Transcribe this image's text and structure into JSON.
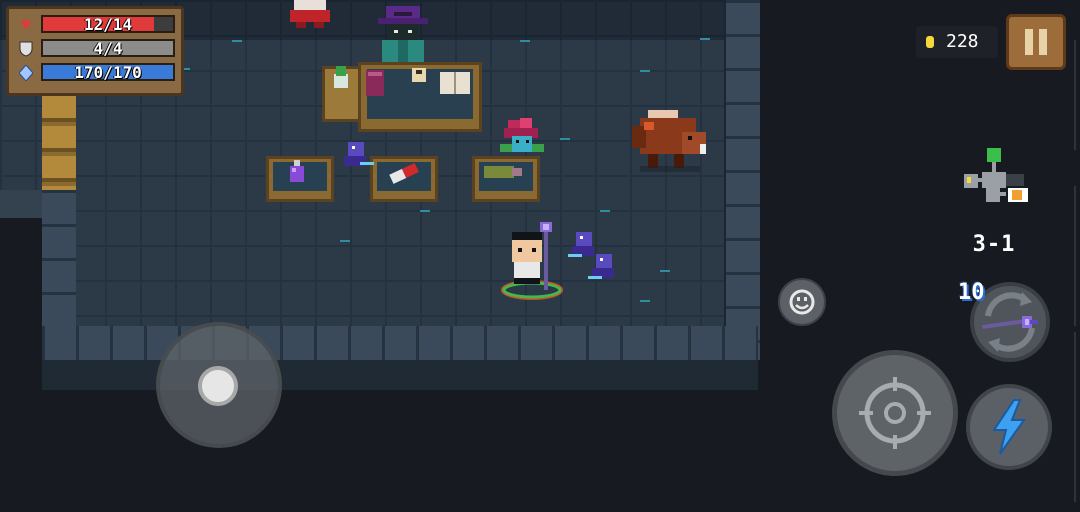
{
  "stats": {
    "hp": {
      "label": "12/14",
      "current": 12,
      "max": 14,
      "color": "#e03a3a"
    },
    "armor": {
      "label": "4/4",
      "current": 4,
      "max": 4,
      "color": "#8c8c8c"
    },
    "energy": {
      "label": "170/170",
      "current": 170,
      "max": 170,
      "color": "#3a7ad8"
    }
  },
  "coins": {
    "amount": "228"
  },
  "level": {
    "name": "3-1"
  },
  "weapon": {
    "energy_cost": "10"
  },
  "icons": {
    "heart": "heart-icon",
    "shield": "shield-icon",
    "energy": "diamond-icon",
    "coin": "coin-icon",
    "pause": "pause-icon",
    "emote": "smiley-icon",
    "attack": "crosshair-icon",
    "skill": "lightning-icon",
    "weapon": "staff-icon"
  },
  "colors": {
    "floor": "#2c3a48",
    "wall": "#3a4a5a",
    "panel": "#8a6a42",
    "skill": "#3ea0f0"
  }
}
